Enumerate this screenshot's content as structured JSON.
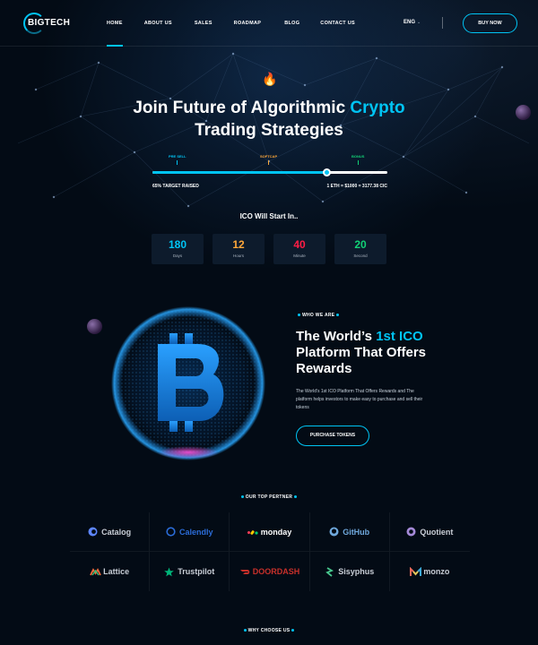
{
  "header": {
    "logo_text": "BIGTECH",
    "nav": [
      "HOME",
      "ABOUT US",
      "SALES",
      "ROADMAP",
      "BLOG",
      "CONTACT US"
    ],
    "active_nav": "HOME",
    "language": "ENG",
    "buy_label": "BUY NOW"
  },
  "hero": {
    "emoji": "🔥",
    "title_part1": "Join Future of Algorithmic ",
    "title_accent": "Crypto",
    "title_part2": "Trading Strategies",
    "stages": {
      "presell": "PRE SELL",
      "softcap": "SOFTCAP",
      "bonus": "BONUS"
    },
    "progress_fraction": 0.74,
    "raised_text": "65% TARGET RAISED",
    "rate_text": "1 ETH = $1000 = 3177.38 CIC"
  },
  "countdown": {
    "heading": "ICO Will Start In..",
    "items": [
      {
        "value": "180",
        "label": "Days",
        "color": "#00c4f4"
      },
      {
        "value": "12",
        "label": "Hours",
        "color": "#ffa83a"
      },
      {
        "value": "40",
        "label": "Minute",
        "color": "#ff1d45"
      },
      {
        "value": "20",
        "label": "Second",
        "color": "#12d176"
      }
    ]
  },
  "about": {
    "tag": "WHO WE ARE",
    "title_part1": "The World’s ",
    "title_accent": "1st ICO",
    "title_part2": " Platform That Offers Rewards",
    "description": "The World’s 1st ICO Platform That Offers Rewards and The platform helps investors to make easy to purchase and sell their tokens",
    "button": "PURCHASE TOKENS"
  },
  "partners": {
    "tag": "OUR TOP PERTNER",
    "items": [
      {
        "name": "Catalog",
        "icon": "catalog-icon",
        "color": "#c9ced6"
      },
      {
        "name": "Calendly",
        "icon": "calendly-icon",
        "color": "#2b6cd8"
      },
      {
        "name": "monday",
        "icon": "monday-icon",
        "color": "#ffffff"
      },
      {
        "name": "GitHub",
        "icon": "github-icon",
        "color": "#6fa8dc"
      },
      {
        "name": "Quotient",
        "icon": "quotient-icon",
        "color": "#c9ced6"
      },
      {
        "name": "Lattice",
        "icon": "lattice-icon",
        "color": "#c9ced6"
      },
      {
        "name": "Trustpilot",
        "icon": "star-icon",
        "color": "#c9ced6"
      },
      {
        "name": "DOORDASH",
        "icon": "doordash-icon",
        "color": "#c8302a"
      },
      {
        "name": "Sisyphus",
        "icon": "sisyphus-icon",
        "color": "#c9ced6"
      },
      {
        "name": "monzo",
        "icon": "monzo-icon",
        "color": "#c9ced6"
      }
    ]
  },
  "why": {
    "tag": "WHY CHOOSE US"
  }
}
